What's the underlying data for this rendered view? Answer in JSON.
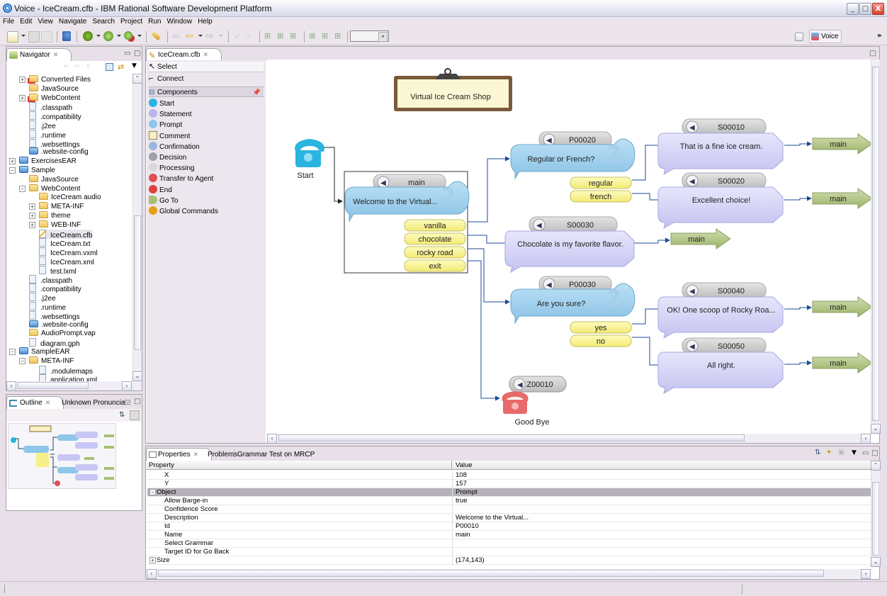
{
  "window": {
    "title": "Voice - IceCream.cfb - IBM Rational Software Development Platform",
    "controls": {
      "minimize": "_",
      "maximize": "□",
      "close": "X"
    }
  },
  "menu": [
    "File",
    "Edit",
    "View",
    "Navigate",
    "Search",
    "Project",
    "Run",
    "Window",
    "Help"
  ],
  "toolbar": {
    "icons": [
      "new-icon",
      "save-icon",
      "print-icon",
      "search-icon",
      "debug-icon",
      "run-icon",
      "external-tools-icon",
      "wand-icon",
      "back-icon",
      "prev-icon",
      "forward-icon",
      "check-icon",
      "validate-icon",
      "layout-tree-icon",
      "layout-vertical-icon",
      "layout-horizontal-icon",
      "layout-grid-icon",
      "layout-fit-icon"
    ],
    "combo_value": "",
    "perspective_label": "Voice",
    "overflow": "»"
  },
  "navigator": {
    "tab_label": "Navigator",
    "items": [
      {
        "label": "Converted Files",
        "type": "folder-error",
        "depth": 2,
        "expander": "+"
      },
      {
        "label": "JavaSource",
        "type": "folder",
        "depth": 2,
        "expander": ""
      },
      {
        "label": "WebContent",
        "type": "folder-error",
        "depth": 2,
        "expander": "+"
      },
      {
        "label": ".classpath",
        "type": "file",
        "depth": 2,
        "expander": ""
      },
      {
        "label": ".compatibility",
        "type": "file",
        "depth": 2,
        "expander": ""
      },
      {
        "label": ".j2ee",
        "type": "file",
        "depth": 2,
        "expander": ""
      },
      {
        "label": ".runtime",
        "type": "file",
        "depth": 2,
        "expander": ""
      },
      {
        "label": ".websettings",
        "type": "file",
        "depth": 2,
        "expander": ""
      },
      {
        "label": ".website-config",
        "type": "config",
        "depth": 2,
        "expander": ""
      },
      {
        "label": "ExercisesEAR",
        "type": "project",
        "depth": 1,
        "expander": "+"
      },
      {
        "label": "Sample",
        "type": "project",
        "depth": 1,
        "expander": "−"
      },
      {
        "label": "JavaSource",
        "type": "folder",
        "depth": 2,
        "expander": ""
      },
      {
        "label": "WebContent",
        "type": "folder",
        "depth": 2,
        "expander": "−"
      },
      {
        "label": "IceCream audio",
        "type": "folder",
        "depth": 3,
        "expander": ""
      },
      {
        "label": "META-INF",
        "type": "folder",
        "depth": 3,
        "expander": "+"
      },
      {
        "label": "theme",
        "type": "folder",
        "depth": 3,
        "expander": "+"
      },
      {
        "label": "WEB-INF",
        "type": "folder",
        "depth": 3,
        "expander": "+"
      },
      {
        "label": "IceCream.cfb",
        "type": "callflow",
        "depth": 3,
        "expander": "",
        "selected": true
      },
      {
        "label": "IceCream.txt",
        "type": "file",
        "depth": 3,
        "expander": ""
      },
      {
        "label": "IceCream.vxml",
        "type": "vxml",
        "depth": 3,
        "expander": ""
      },
      {
        "label": "IceCream.xml",
        "type": "file",
        "depth": 3,
        "expander": ""
      },
      {
        "label": "test.lxml",
        "type": "file",
        "depth": 3,
        "expander": ""
      },
      {
        "label": ".classpath",
        "type": "file",
        "depth": 2,
        "expander": ""
      },
      {
        "label": ".compatibility",
        "type": "file",
        "depth": 2,
        "expander": ""
      },
      {
        "label": ".j2ee",
        "type": "file",
        "depth": 2,
        "expander": ""
      },
      {
        "label": ".runtime",
        "type": "file",
        "depth": 2,
        "expander": ""
      },
      {
        "label": ".websettings",
        "type": "file",
        "depth": 2,
        "expander": ""
      },
      {
        "label": ".website-config",
        "type": "config",
        "depth": 2,
        "expander": ""
      },
      {
        "label": "AudioPrompt.vap",
        "type": "audio",
        "depth": 2,
        "expander": ""
      },
      {
        "label": "diagram.gph",
        "type": "graph",
        "depth": 2,
        "expander": ""
      },
      {
        "label": "SampleEAR",
        "type": "project",
        "depth": 1,
        "expander": "−"
      },
      {
        "label": "META-INF",
        "type": "folder",
        "depth": 2,
        "expander": "−"
      },
      {
        "label": ".modulemaps",
        "type": "file",
        "depth": 3,
        "expander": ""
      },
      {
        "label": "application.xml",
        "type": "file",
        "depth": 3,
        "expander": ""
      }
    ]
  },
  "outline": {
    "tab_label": "Outline",
    "tab2_label": "Unknown Pronuncia..."
  },
  "editor": {
    "tab_label": "IceCream.cfb",
    "palette": {
      "tools": [
        {
          "label": "Select",
          "icon": "cursor-arrow-icon"
        },
        {
          "label": "Connect",
          "icon": "connection-icon"
        }
      ],
      "drawer_label": "Components",
      "components": [
        {
          "label": "Start",
          "icon": "phone-start-icon",
          "color": "#2ab4e0"
        },
        {
          "label": "Statement",
          "icon": "statement-icon",
          "color": "#b9b6ec"
        },
        {
          "label": "Prompt",
          "icon": "prompt-icon",
          "color": "#8ec6ea"
        },
        {
          "label": "Comment",
          "icon": "comment-icon",
          "color": "#f8f0c0"
        },
        {
          "label": "Confirmation",
          "icon": "confirmation-icon",
          "color": "#9ab6e0"
        },
        {
          "label": "Decision",
          "icon": "decision-icon",
          "color": "#a0a0a8"
        },
        {
          "label": "Processing",
          "icon": "processing-icon",
          "color": "#d8d8d8"
        },
        {
          "label": "Transfer to Agent",
          "icon": "transfer-agent-icon",
          "color": "#e05050"
        },
        {
          "label": "End",
          "icon": "phone-end-icon",
          "color": "#e04040"
        },
        {
          "label": "Go To",
          "icon": "goto-arrow-icon",
          "color": "#a8c070"
        },
        {
          "label": "Global Commands",
          "icon": "global-commands-icon",
          "color": "#e8a010"
        }
      ]
    },
    "diagram": {
      "comment": "Virtual Ice Cream Shop",
      "start_label": "Start",
      "end": {
        "id": "Z00010",
        "label": "Good Bye"
      },
      "main_prompt": {
        "id": "main",
        "text": "Welcome to the Virtual...",
        "choices": [
          "vanilla",
          "chocolate",
          "rocky road",
          "exit"
        ]
      },
      "prompts": [
        {
          "id": "P00020",
          "text": "Regular or French?",
          "choices": [
            "regular",
            "french"
          ]
        },
        {
          "id": "P00030",
          "text": "Are you sure?",
          "choices": [
            "yes",
            "no"
          ]
        }
      ],
      "statements": [
        {
          "id": "S00010",
          "text": "That is a fine ice cream."
        },
        {
          "id": "S00020",
          "text": "Excellent choice!"
        },
        {
          "id": "S00030",
          "text": "Chocolate is my favorite flavor."
        },
        {
          "id": "S00040",
          "text": "OK! One scoop of Rocky Roa..."
        },
        {
          "id": "S00050",
          "text": "All right."
        }
      ],
      "goto_label": "main"
    }
  },
  "properties": {
    "tabs": [
      "Properties",
      "Problems",
      "Grammar Test on MRCP"
    ],
    "columns": [
      "Property",
      "Value"
    ],
    "rows": [
      {
        "key": "X",
        "value": "108",
        "indent": true
      },
      {
        "key": "Y",
        "value": "157",
        "indent": true
      },
      {
        "key": "Object",
        "value": "Prompt",
        "expander": "−",
        "selected": true
      },
      {
        "key": "Allow Barge-in",
        "value": "true",
        "indent": true
      },
      {
        "key": "Confidence Score",
        "value": "",
        "indent": true
      },
      {
        "key": "Description",
        "value": "Welcome to the Virtual...",
        "indent": true
      },
      {
        "key": "Id",
        "value": "P00010",
        "indent": true
      },
      {
        "key": "Name",
        "value": "main",
        "indent": true
      },
      {
        "key": "Select Grammar",
        "value": "",
        "indent": true
      },
      {
        "key": "Target ID for Go Back",
        "value": "",
        "indent": true
      },
      {
        "key": "Size",
        "value": "(174,143)",
        "expander": "+"
      }
    ]
  }
}
